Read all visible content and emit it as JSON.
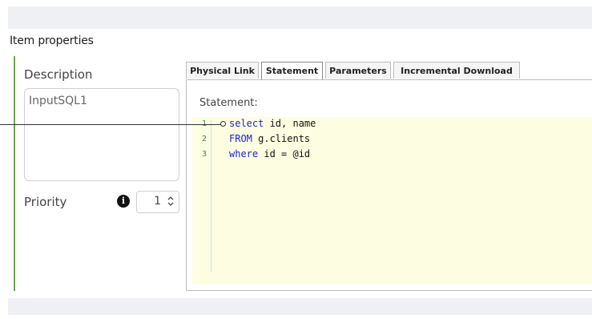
{
  "panel": {
    "title": "Item properties"
  },
  "description": {
    "label": "Description",
    "value": "InputSQL1"
  },
  "priority": {
    "label": "Priority",
    "info_icon": "info-icon",
    "value": "1"
  },
  "tabs": [
    {
      "label": "Physical Link",
      "active": false
    },
    {
      "label": "Statement",
      "active": true
    },
    {
      "label": "Parameters",
      "active": false
    },
    {
      "label": "Incremental Download",
      "active": false
    }
  ],
  "statement": {
    "label": "Statement:",
    "lines": [
      {
        "num": "1",
        "kw": "select",
        "rest": " id, name"
      },
      {
        "num": "2",
        "kw": "FROM",
        "rest": " g.clients"
      },
      {
        "num": "3",
        "kw": "where",
        "rest": " id = @id"
      }
    ]
  },
  "colors": {
    "accent_green": "#6aa84f",
    "editor_bg": "#fdfde2",
    "keyword_blue": "#2020d0"
  }
}
